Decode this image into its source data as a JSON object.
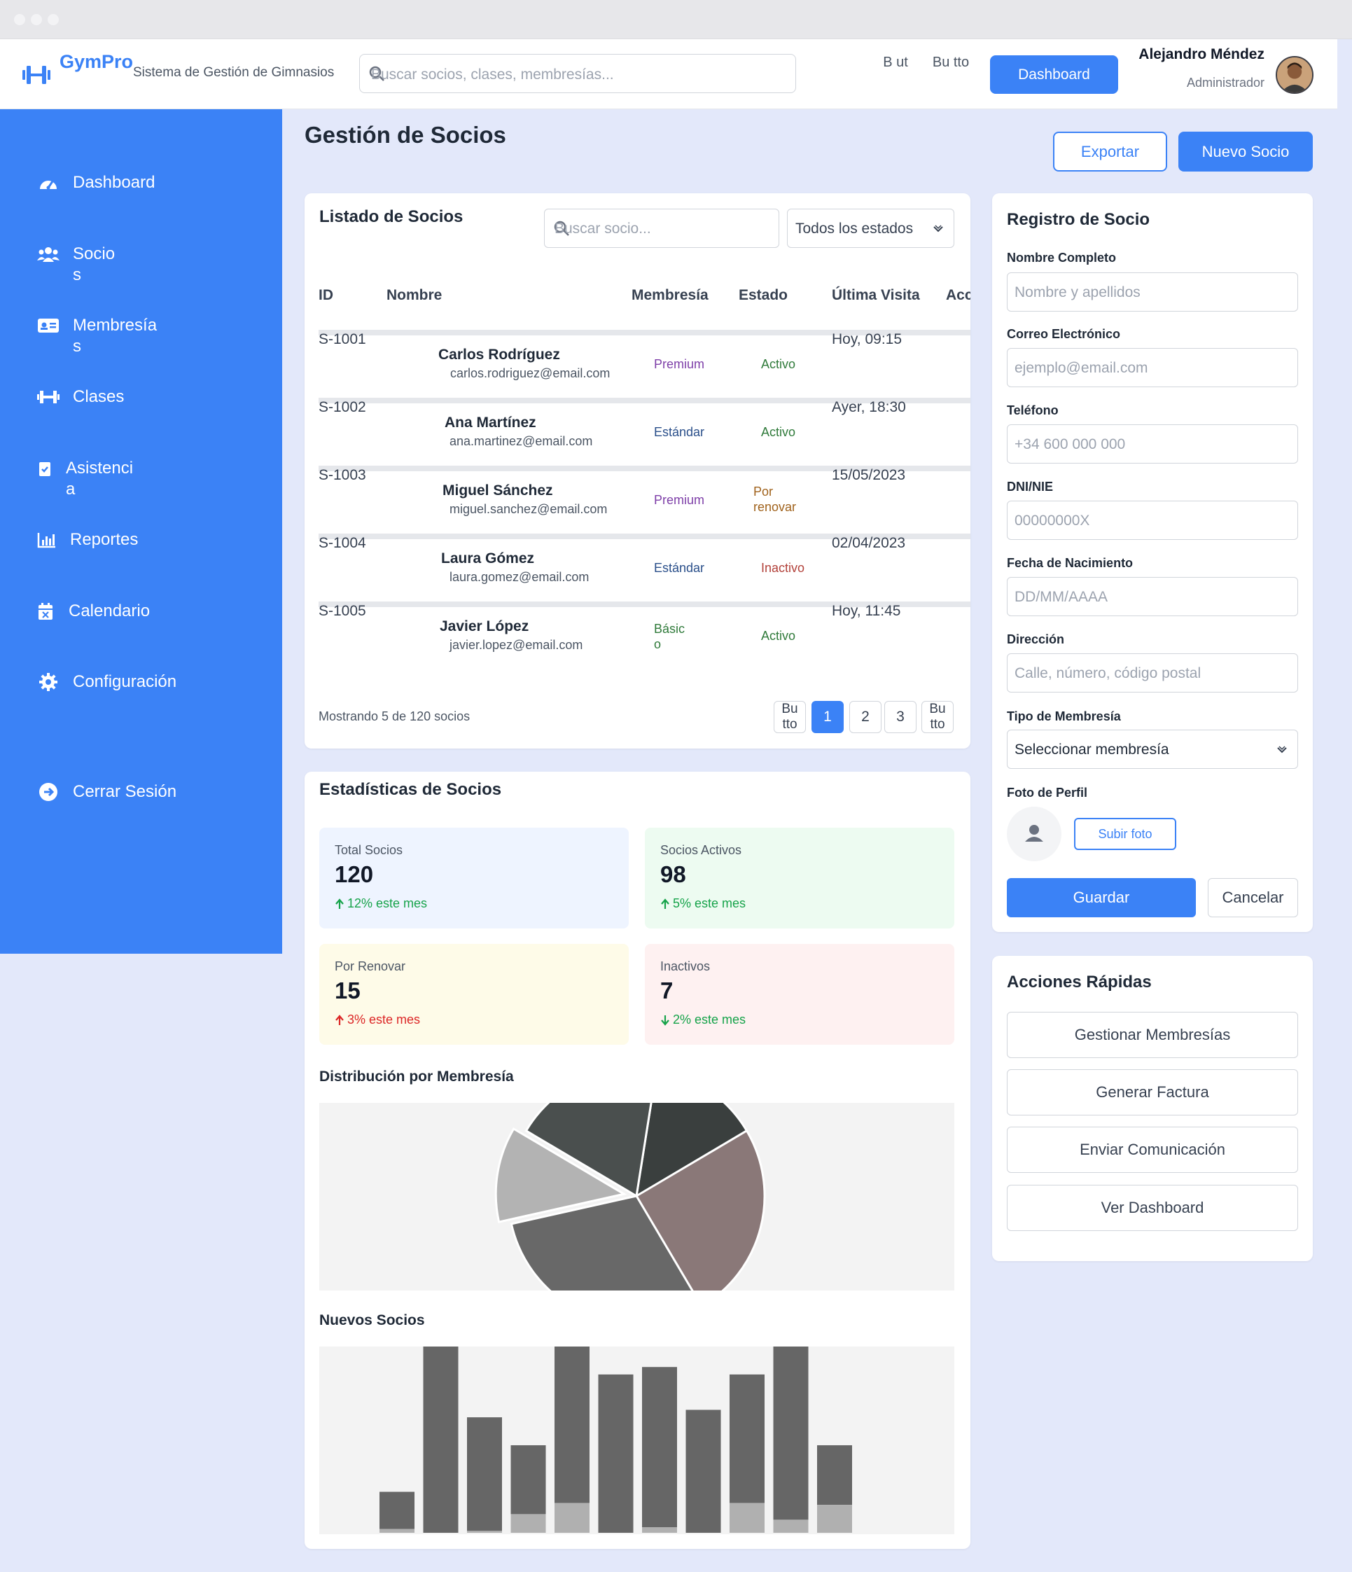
{
  "app": {
    "brand": "GymPro",
    "tagline": "Sistema de Gestión de Gimnasios",
    "search_placeholder": "Buscar socios, clases, membresías...",
    "header_buttons": [
      "B ut",
      "Bu tto"
    ],
    "dashboard_button": "Dashboard",
    "user_name": "Alejandro Méndez",
    "user_role": "Administrador"
  },
  "sidebar": {
    "items": [
      {
        "label": "Dashboard",
        "icon": "gauge-icon"
      },
      {
        "label": "Socio s",
        "icon": "users-icon"
      },
      {
        "label": "Membresía s",
        "icon": "id-card-icon"
      },
      {
        "label": "Clases",
        "icon": "dumbbell-icon"
      },
      {
        "label": "Asistenci a",
        "icon": "clipboard-check-icon"
      },
      {
        "label": "Reportes",
        "icon": "chart-bar-icon"
      },
      {
        "label": "Calendario",
        "icon": "calendar-icon"
      },
      {
        "label": "Configuración",
        "icon": "gear-icon"
      },
      {
        "label": "Cerrar Sesión",
        "icon": "logout-icon"
      }
    ]
  },
  "page": {
    "title": "Gestión de Socios",
    "export_button": "Exportar",
    "new_button": "Nuevo Socio"
  },
  "list": {
    "title": "Listado de Socios",
    "search_placeholder": "Buscar socio...",
    "state_filter": "Todos los estados",
    "columns": [
      "ID",
      "Nombre",
      "Membresía",
      "Estado",
      "Última Visita",
      "Acciones"
    ],
    "rows": [
      {
        "id": "S-1001",
        "name": "Carlos Rodríguez",
        "email": "carlos.rodriguez@email.com",
        "membership": "Premium",
        "status": "Activo",
        "last_visit": "Hoy, 09:15"
      },
      {
        "id": "S-1002",
        "name": "Ana Martínez",
        "email": "ana.martinez@email.com",
        "membership": "Estándar",
        "status": "Activo",
        "last_visit": "Ayer, 18:30"
      },
      {
        "id": "S-1003",
        "name": "Miguel Sánchez",
        "email": "miguel.sanchez@email.com",
        "membership": "Premium",
        "status": "Por renovar",
        "last_visit": "15/05/2023"
      },
      {
        "id": "S-1004",
        "name": "Laura Gómez",
        "email": "laura.gomez@email.com",
        "membership": "Estándar",
        "status": "Inactivo",
        "last_visit": "02/04/2023"
      },
      {
        "id": "S-1005",
        "name": "Javier López",
        "email": "javier.lopez@email.com",
        "membership": "Básic o",
        "status": "Activo",
        "last_visit": "Hoy, 11:45"
      }
    ],
    "footer": "Mostrando 5 de 120 socios",
    "pagination": {
      "prev": "Bu tto",
      "pages": [
        "1",
        "2",
        "3"
      ],
      "next": "Bu tto",
      "current": "1"
    }
  },
  "stats": {
    "title": "Estadísticas de Socios",
    "cards": [
      {
        "label": "Total Socios",
        "value": "120",
        "delta": "12% este mes",
        "trend": "up",
        "color": "#16a34a",
        "bg": "#eef4ff"
      },
      {
        "label": "Socios Activos",
        "value": "98",
        "delta": "5% este mes",
        "trend": "up",
        "color": "#16a34a",
        "bg": "#edfbf1"
      },
      {
        "label": "Por Renovar",
        "value": "15",
        "delta": "3% este mes",
        "trend": "up",
        "color": "#dc2626",
        "bg": "#fefbe8"
      },
      {
        "label": "Inactivos",
        "value": "7",
        "delta": "2% este mes",
        "trend": "down",
        "color": "#16a34a",
        "bg": "#fef1f1"
      }
    ],
    "pie_title": "Distribución por Membresía",
    "bar_title": "Nuevos Socios"
  },
  "chart_data": [
    {
      "type": "pie",
      "title": "Distribución por Membresía",
      "slices": [
        {
          "value": 14,
          "color": "#3a3f3e"
        },
        {
          "value": 25,
          "color": "#8a7878"
        },
        {
          "value": 30,
          "color": "#686868"
        },
        {
          "value": 12,
          "color": "#b3b3b3",
          "exploded": true
        },
        {
          "value": 19,
          "color": "#4a4f4e"
        }
      ]
    },
    {
      "type": "bar",
      "title": "Nuevos Socios",
      "ylim": [
        0,
        100
      ],
      "series": [
        {
          "values": [
            22,
            100,
            62,
            47,
            100,
            85,
            89,
            66,
            85,
            100,
            47
          ],
          "color": "#666666"
        },
        {
          "values": [
            2,
            0,
            1,
            10,
            16,
            0,
            3,
            0,
            16,
            7,
            15
          ],
          "color": "#b0b0b0"
        }
      ]
    }
  ],
  "registro": {
    "title": "Registro de Socio",
    "fields": [
      {
        "label": "Nombre Completo",
        "placeholder": "Nombre y apellidos"
      },
      {
        "label": "Correo Electrónico",
        "placeholder": "ejemplo@email.com"
      },
      {
        "label": "Teléfono",
        "placeholder": "+34 600 000 000"
      },
      {
        "label": "DNI/NIE",
        "placeholder": "00000000X"
      },
      {
        "label": "Fecha de Nacimiento",
        "placeholder": "DD/MM/AAAA"
      },
      {
        "label": "Dirección",
        "placeholder": "Calle, número, código postal"
      }
    ],
    "membership_label": "Tipo de Membresía",
    "membership_value": "Seleccionar membresía",
    "photo_label": "Foto de Perfil",
    "upload_button": "Subir foto",
    "save_button": "Guardar",
    "cancel_button": "Cancelar"
  },
  "quick_actions": {
    "title": "Acciones Rápidas",
    "buttons": [
      "Gestionar Membresías",
      "Generar Factura",
      "Enviar Comunicación",
      "Ver Dashboard"
    ]
  },
  "colors": {
    "accent": "#3b82f6",
    "premium": "#7e3fa8",
    "estandar": "#2a4f8a",
    "basico": "#2f7a3a",
    "activo": "#2f7a3a",
    "por_renovar": "#a0621c",
    "inactivo": "#b2413a"
  }
}
